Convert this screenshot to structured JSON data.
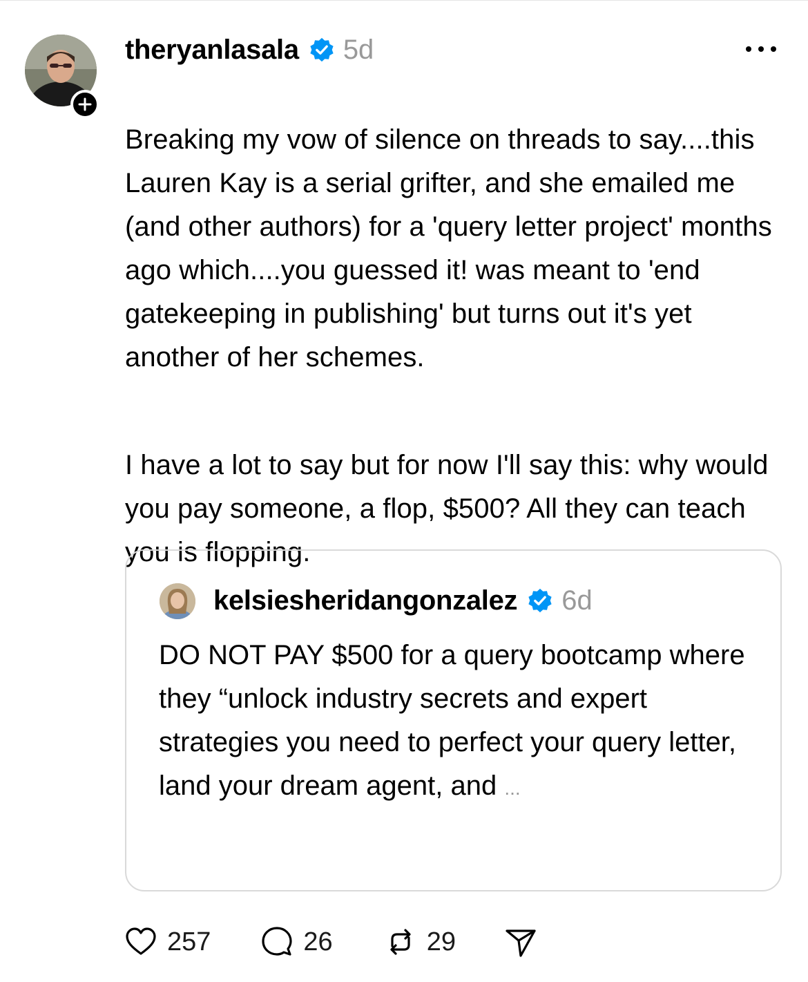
{
  "post": {
    "username": "theryanlasala",
    "time": "5d",
    "paragraphs": [
      "Breaking my vow of silence on threads to say....this Lauren Kay is a serial grifter, and she emailed me (and other authors) for a 'query letter project' months ago which....you guessed it! was meant to 'end gatekeeping in publishing' but turns out it's yet another of her schemes.",
      "I have a lot to say but for now I'll say this: why would you pay someone, a flop, $500? All they can teach you is flopping."
    ],
    "avatar_icon": "profile-photo",
    "follow_icon": "plus-icon",
    "verified_icon": "verified-badge-icon",
    "more_icon": "more-options-icon"
  },
  "quote": {
    "username": "kelsiesheridangonzalez",
    "time": "6d",
    "text": "DO NOT PAY $500 for a query bootcamp where they “unlock industry secrets and expert strategies you need to perfect your query letter, land your dream agent, and",
    "ellipsis": "..."
  },
  "actions": {
    "likes": "257",
    "comments": "26",
    "reposts": "29",
    "like_icon": "heart-icon",
    "comment_icon": "comment-bubble-icon",
    "repost_icon": "repost-icon",
    "share_icon": "send-icon"
  },
  "colors": {
    "verified_blue": "#0095f6",
    "muted_text": "#999999",
    "card_border": "#d9d9d9"
  }
}
